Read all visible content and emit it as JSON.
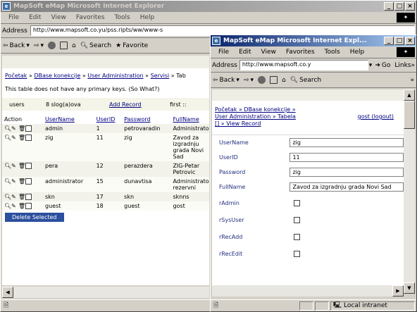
{
  "back_window": {
    "title": "MapSoft  eMap  Microsoft Internet Explorer",
    "menu": [
      "File",
      "Edit",
      "View",
      "Favorites",
      "Tools",
      "Help"
    ],
    "address_label": "Address",
    "address_value": "http://www.mapsoft.co.yu/pss.ripts/ww/www-s",
    "toolbar": {
      "back": "Back",
      "search": "Search",
      "favorites": "Favorite"
    },
    "breadcrumb": [
      "Početak",
      "DBase konekcije",
      "User Administration",
      "Servisi",
      "Tab"
    ],
    "breadcrumb_sep": "»",
    "notice": "This table does not have any primary keys. (So What?)",
    "table_bar": {
      "name": "users",
      "count": "8 slog(a)ova",
      "add": "Add Record",
      "first": "first ::"
    },
    "columns": [
      "Action",
      "UserName",
      "UserID",
      "Password",
      "FullName"
    ],
    "rows": [
      {
        "username": "admin",
        "userid": "1",
        "password": "petrovaradin",
        "fullname": "Administrator"
      },
      {
        "username": "zig",
        "userid": "11",
        "password": "zig",
        "fullname": "Zavod za izgradnju grada Novi Sad"
      },
      {
        "username": "pera",
        "userid": "12",
        "password": "perazdera",
        "fullname": "ZIG-Petar Petrovic"
      },
      {
        "username": "administrator",
        "userid": "15",
        "password": "dunavtisa",
        "fullname": "Administrator rezervni"
      },
      {
        "username": "skn",
        "userid": "17",
        "password": "skn",
        "fullname": "sknns"
      },
      {
        "username": "guest",
        "userid": "18",
        "password": "guest",
        "fullname": "gost"
      }
    ],
    "delete_button": "Delete Selected"
  },
  "front_window": {
    "title": "MapSoft  eMap  Microsoft Internet Expl...",
    "menu": [
      "File",
      "Edit",
      "View",
      "Favorites",
      "Tools",
      "Help"
    ],
    "address_label": "Address",
    "address_value": "http://www.mapsoft.co.y",
    "go": "Go",
    "links": "Links",
    "toolbar": {
      "back": "Back",
      "search": "Search"
    },
    "breadcrumb": {
      "line1": "Početak » DBase konekcije »",
      "line2": "User Administration » Tabela",
      "line3": "[] » View Record",
      "user": "gost (logout)"
    },
    "fields": [
      {
        "label": "UserName",
        "value": "zig",
        "type": "text"
      },
      {
        "label": "UserID",
        "value": "11",
        "type": "text"
      },
      {
        "label": "Password",
        "value": "zig",
        "type": "text"
      },
      {
        "label": "FullName",
        "value": "Zavod za izgradnju grada Novi Sad",
        "type": "text"
      },
      {
        "label": "rAdmin",
        "value": "",
        "type": "checkbox"
      },
      {
        "label": "rSysUser",
        "value": "",
        "type": "checkbox"
      },
      {
        "label": "rRecAdd",
        "value": "",
        "type": "checkbox"
      },
      {
        "label": "rRecEdit",
        "value": "",
        "type": "checkbox"
      }
    ],
    "status_zone": "Local intranet"
  }
}
